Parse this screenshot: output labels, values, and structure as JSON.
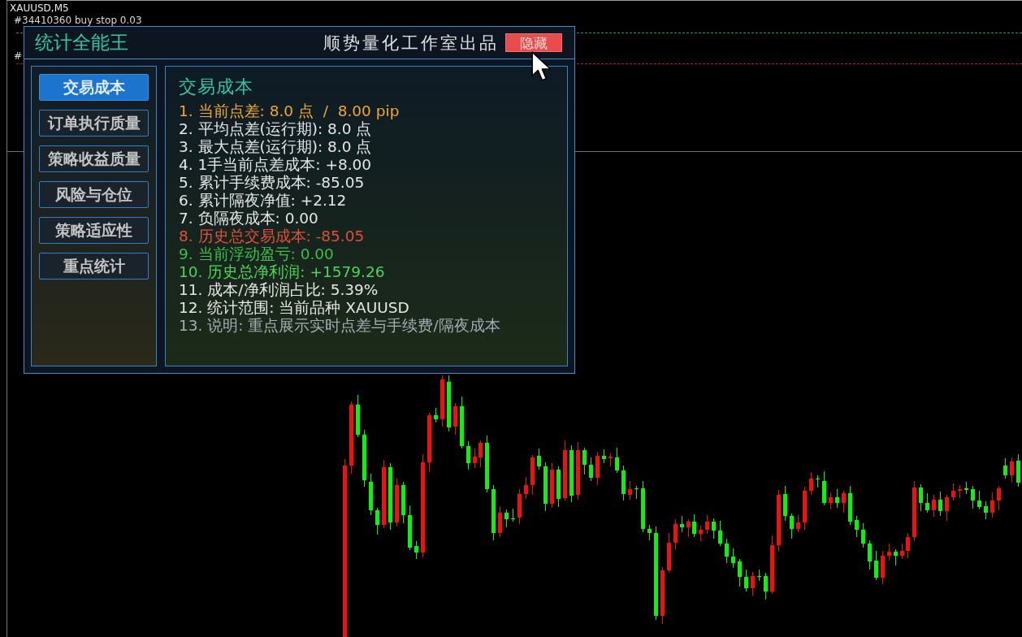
{
  "chart": {
    "symbol": "XAUUSD,M5",
    "price_lines": [
      {
        "kind": "dashed",
        "label": "#34410360 buy stop 0.03",
        "color": "#2e9e2e"
      },
      {
        "kind": "dashed",
        "label": "#",
        "color": "#c81414"
      },
      {
        "kind": "solid",
        "color": "#707070"
      }
    ]
  },
  "panel": {
    "title": "统计全能王",
    "subtitle": "顺势量化工作室出品",
    "hide_button": "隐藏",
    "tabs": [
      {
        "label": "交易成本",
        "selected": true
      },
      {
        "label": "订单执行质量",
        "selected": false
      },
      {
        "label": "策略收益质量",
        "selected": false
      },
      {
        "label": "风险与仓位",
        "selected": false
      },
      {
        "label": "策略适应性",
        "selected": false
      },
      {
        "label": "重点统计",
        "selected": false
      }
    ],
    "section": {
      "heading": "交易成本",
      "lines": [
        {
          "text": "1. 当前点差: 8.0 点  /  8.00 pip",
          "color": "#f0a830"
        },
        {
          "text": "2. 平均点差(运行期): 8.0 点",
          "color": "#e6e6e6"
        },
        {
          "text": "3. 最大点差(运行期): 8.0 点",
          "color": "#e6e6e6"
        },
        {
          "text": "4. 1手当前点差成本: +8.00",
          "color": "#e6e6e6"
        },
        {
          "text": "5. 累计手续费成本: -85.05",
          "color": "#e6e6e6"
        },
        {
          "text": "6. 累计隔夜净值: +2.12",
          "color": "#e6e6e6"
        },
        {
          "text": "7. 负隔夜成本: 0.00",
          "color": "#e6e6e6"
        },
        {
          "text": "8. 历史总交易成本: -85.05",
          "color": "#e2503c"
        },
        {
          "text": "9. 当前浮动盈亏: 0.00",
          "color": "#3cbf4a"
        },
        {
          "text": "10. 历史总净利润: +1579.26",
          "color": "#4cd65a"
        },
        {
          "text": "11. 成本/净利润占比: 5.39%",
          "color": "#e6e6e6"
        },
        {
          "text": "12. 统计范围: 当前品种 XAUUSD",
          "color": "#e6e6e6"
        },
        {
          "text": "13. 说明: 重点展示实时点差与手续费/隔夜成本",
          "color": "#a4acb4"
        }
      ]
    }
  }
}
